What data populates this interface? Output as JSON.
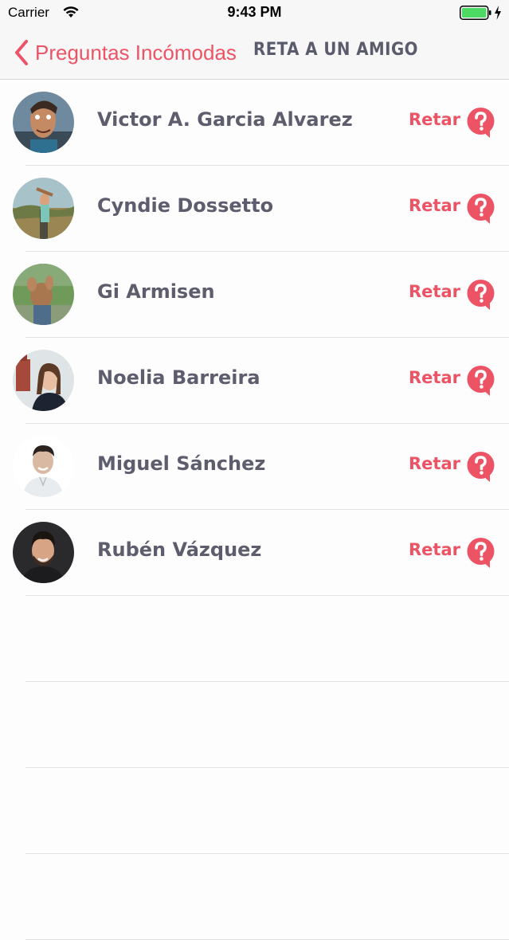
{
  "status_bar": {
    "carrier": "Carrier",
    "time": "9:43 PM",
    "battery_color": "#4cd964"
  },
  "nav": {
    "back_label": "Preguntas Incómodas",
    "title": "RETA A UN AMIGO",
    "accent_color": "#ec5466"
  },
  "friends": [
    {
      "name": "Victor A. Garcia Alvarez",
      "action": "Retar"
    },
    {
      "name": "Cyndie Dossetto",
      "action": "Retar"
    },
    {
      "name": "Gi Armisen",
      "action": "Retar"
    },
    {
      "name": "Noelia Barreira",
      "action": "Retar"
    },
    {
      "name": "Miguel Sánchez",
      "action": "Retar"
    },
    {
      "name": "Rubén Vázquez",
      "action": "Retar"
    }
  ]
}
